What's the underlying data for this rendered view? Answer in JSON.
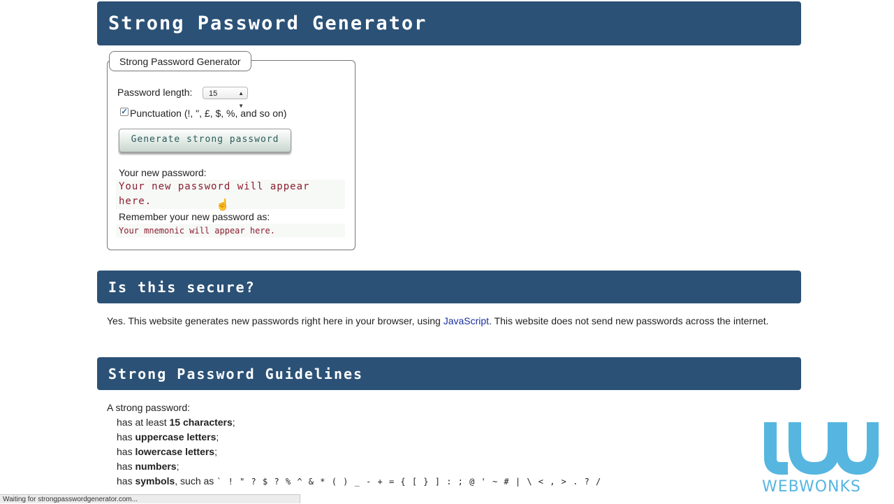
{
  "header": {
    "title": "Strong Password Generator"
  },
  "generator": {
    "legend": "Strong Password Generator",
    "length_label": "Password length:",
    "length_value": "15",
    "punctuation_checked": true,
    "punctuation_label": "Punctuation (!, \", £, $, %, and so on)",
    "button_label": "Generate strong password",
    "new_password_label": "Your new password:",
    "new_password_line1": "Your new password will appear",
    "new_password_line2": "here.",
    "mnemonic_label": "Remember your new password as:",
    "mnemonic_placeholder": "Your mnemonic will appear here."
  },
  "secure": {
    "title": "Is this secure?",
    "text_before": "Yes. This website generates new passwords right here in your browser, using ",
    "link": "JavaScript",
    "text_after": ". This website does not send new passwords across the internet."
  },
  "guidelines": {
    "title": "Strong Password Guidelines",
    "intro": "A strong password:",
    "items": [
      {
        "pre": "has at least ",
        "bold": "15 characters",
        "post": ";"
      },
      {
        "pre": "has ",
        "bold": "uppercase letters",
        "post": ";"
      },
      {
        "pre": "has ",
        "bold": "lowercase letters",
        "post": ";"
      },
      {
        "pre": "has ",
        "bold": "numbers",
        "post": ";"
      },
      {
        "pre": "has ",
        "bold": "symbols",
        "post": ", such as "
      }
    ],
    "symbols": "` ! \" ? $ ? % ^ & * ( ) _ - + = { [ } ] : ; @ ' ~ # | \\ < , > . ? /"
  },
  "status_bar": {
    "text": "Waiting for strongpasswordgenerator.com..."
  },
  "watermark": {
    "text": "WEBWONKS",
    "color": "#56b6e0"
  }
}
